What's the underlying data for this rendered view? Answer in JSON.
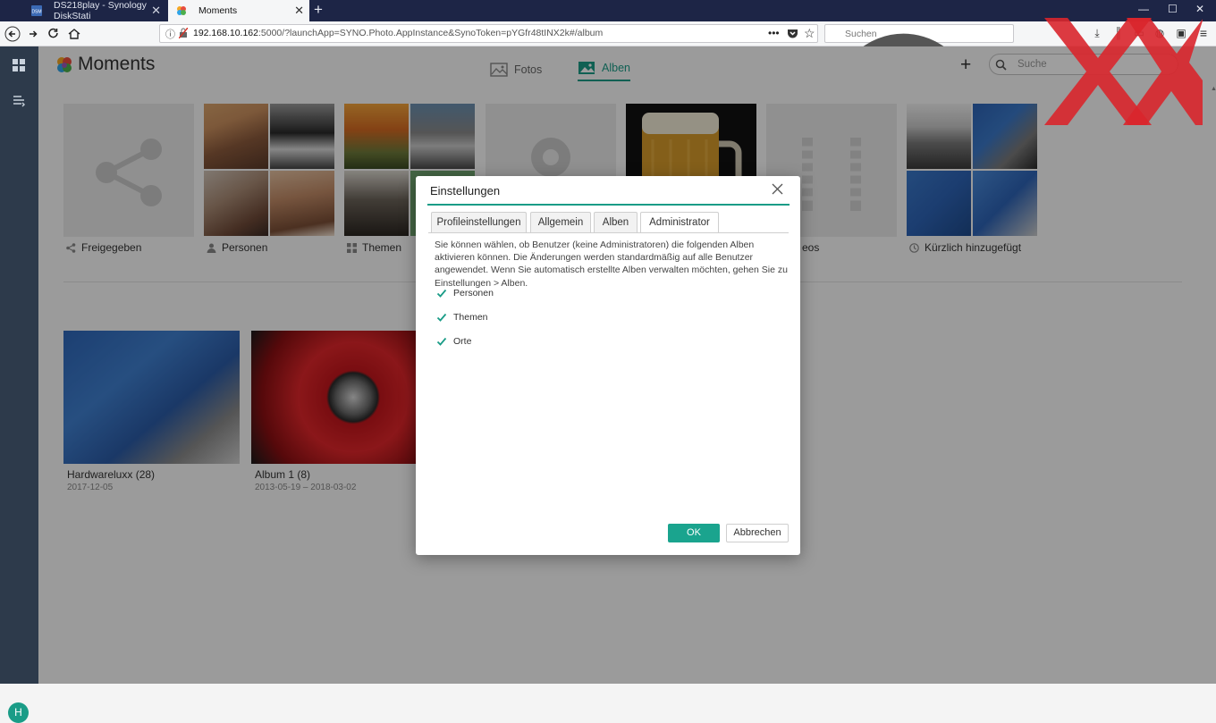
{
  "browser": {
    "tabs": [
      {
        "title": "DS218play - Synology DiskStati"
      },
      {
        "title": "Moments"
      }
    ],
    "url_host": "192.168.10.162",
    "url_rest": ":5000/?launchApp=SYNO.Photo.AppInstance&SynoToken=pYGfr48tINX2k#/album",
    "search_placeholder": "Suchen"
  },
  "app": {
    "title": "Moments",
    "tabs": [
      {
        "label": "Fotos",
        "active": false
      },
      {
        "label": "Alben",
        "active": true
      }
    ],
    "search_placeholder": "Suche",
    "avatar_initial": "H",
    "accent_color": "#1a9c87"
  },
  "smart_albums": [
    {
      "label": "Freigegeben",
      "icon": "share-icon"
    },
    {
      "label": "Personen",
      "icon": "person-icon"
    },
    {
      "label": "Themen",
      "icon": "grid-icon"
    },
    {
      "label": "",
      "icon": "place-icon"
    },
    {
      "label": "",
      "icon": "image-icon"
    },
    {
      "label": "eos",
      "icon": "video-icon"
    },
    {
      "label": "Kürzlich hinzugefügt",
      "icon": "clock-icon"
    }
  ],
  "albums": [
    {
      "name": "Hardwareluxx (28)",
      "date": "2017-12-05"
    },
    {
      "name": "Album 1 (8)",
      "date": "2013-05-19 – 2018-03-02"
    }
  ],
  "dialog": {
    "title": "Einstellungen",
    "tabs": [
      {
        "label": "Profileinstellungen",
        "active": false
      },
      {
        "label": "Allgemein",
        "active": false
      },
      {
        "label": "Alben",
        "active": false
      },
      {
        "label": "Administrator",
        "active": true
      }
    ],
    "description": "Sie können wählen, ob Benutzer (keine Administratoren) die folgenden Alben aktivieren können. Die Änderungen werden standardmäßig auf alle Benutzer angewendet. Wenn Sie automatisch erstellte Alben verwalten möchten, gehen Sie zu Einstellungen > Alben.",
    "checkboxes": [
      {
        "label": "Personen",
        "checked": true
      },
      {
        "label": "Themen",
        "checked": true
      },
      {
        "label": "Orte",
        "checked": true
      }
    ],
    "ok_label": "OK",
    "cancel_label": "Abbrechen"
  }
}
